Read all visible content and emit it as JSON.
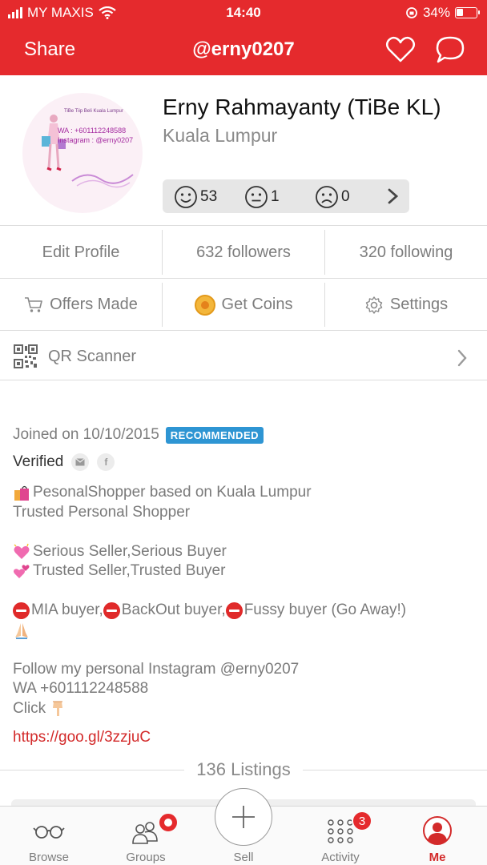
{
  "status_bar": {
    "carrier": "MY MAXIS",
    "time": "14:40",
    "battery": "34%",
    "battery_level": 0.34
  },
  "header": {
    "share_label": "Share",
    "username": "@erny0207",
    "icons": [
      "heart-icon",
      "chat-bubble-icon"
    ]
  },
  "profile": {
    "name": "Erny Rahmayanty (TiBe KL)",
    "location": "Kuala Lumpur",
    "avatar_text": {
      "top": "TiBe Tiip Beli Kuala Lumpur",
      "wa": "WA : +601112248588",
      "instagram": "Instagram : @erny0207"
    },
    "ratings": {
      "positive": "53",
      "neutral": "1",
      "negative": "0"
    }
  },
  "stats_row": {
    "edit_profile": "Edit Profile",
    "followers": "632 followers",
    "following": "320 following"
  },
  "actions_row": {
    "offers_made": "Offers Made",
    "get_coins": "Get Coins",
    "settings": "Settings"
  },
  "qr_row": {
    "label": "QR Scanner"
  },
  "bio": {
    "joined": "Joined on 10/10/2015",
    "badge": "RECOMMENDED",
    "verified": "Verified",
    "lines": {
      "l1": "PesonalShopper based on Kuala Lumpur",
      "l2": "Trusted Personal Shopper",
      "l3": "Serious Seller,Serious Buyer",
      "l4": "Trusted Seller,Trusted Buyer",
      "l5a": "MIA buyer,",
      "l5b": "BackOut buyer,",
      "l5c": "Fussy buyer (Go Away!)",
      "l6": "Follow my personal Instagram @erny0207",
      "l7": "WA +601112248588",
      "l8": "Click"
    },
    "link": "https://goo.gl/3zzjuC"
  },
  "listings": {
    "label": "136 Listings"
  },
  "tabbar": {
    "browse": "Browse",
    "groups": "Groups",
    "sell": "Sell",
    "activity": "Activity",
    "activity_badge": "3",
    "me": "Me"
  },
  "colors": {
    "brand_red": "#e52a2d",
    "badge_blue": "#2e95d3",
    "link_red": "#d32a2a"
  }
}
